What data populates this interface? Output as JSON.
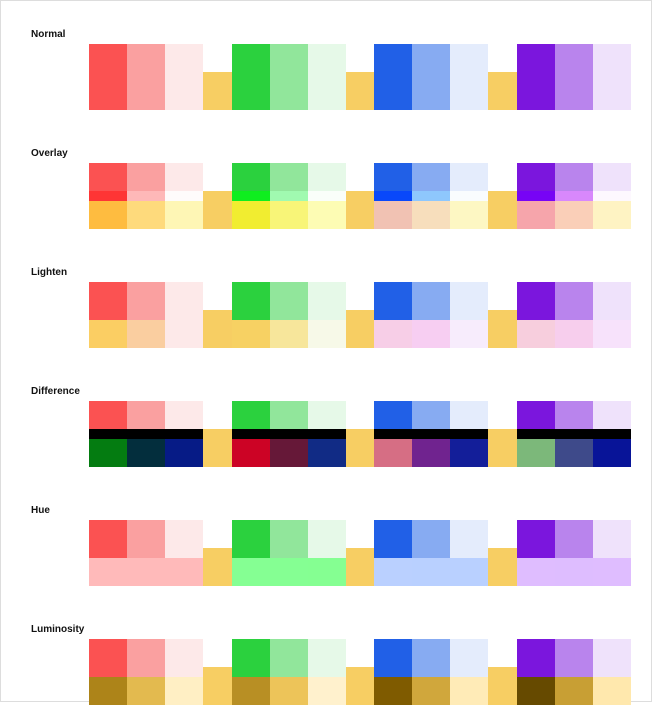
{
  "sections": [
    {
      "label": "Normal",
      "mode": "normal"
    },
    {
      "label": "Overlay",
      "mode": "overlay"
    },
    {
      "label": "Lighten",
      "mode": "lighten"
    },
    {
      "label": "Difference",
      "mode": "difference"
    },
    {
      "label": "Hue",
      "mode": "hue"
    },
    {
      "label": "Luminosity",
      "mode": "luminosity"
    }
  ],
  "background_bar": "#f7ce63",
  "palette_groups": [
    [
      "#fb5252",
      "#faa0a0",
      "#fde9e9"
    ],
    [
      "#2bd13e",
      "#91e69b",
      "#e6f9e8"
    ],
    [
      "#2160e7",
      "#87abf2",
      "#e4ecfc"
    ],
    [
      "#7b16dd",
      "#b984ed",
      "#efe2fb"
    ]
  ]
}
